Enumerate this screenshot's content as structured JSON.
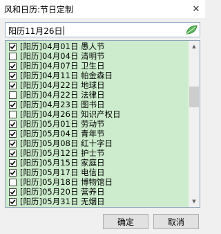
{
  "window": {
    "title": "风和日历:节日定制",
    "close_glyph": "✕"
  },
  "search": {
    "value": "阳历11月26日",
    "icon": "leaf-icon"
  },
  "list": {
    "items": [
      {
        "label": "[阳历]04月01日  愚人节",
        "checked": true
      },
      {
        "label": "[阳历]04月04日  清明节",
        "checked": false
      },
      {
        "label": "[阳历]04月07日  卫生日",
        "checked": true
      },
      {
        "label": "[阳历]04月11日  帕金森日",
        "checked": true
      },
      {
        "label": "[阳历]04月22日  地球日",
        "checked": true
      },
      {
        "label": "[阳历]04月22日  法律日",
        "checked": false
      },
      {
        "label": "[阳历]04月23日  图书日",
        "checked": true
      },
      {
        "label": "[阳历]04月26日  知识产权日",
        "checked": false
      },
      {
        "label": "[阳历]05月01日  劳动节",
        "checked": true
      },
      {
        "label": "[阳历]05月04日  青年节",
        "checked": true
      },
      {
        "label": "[阳历]05月08日  红十字日",
        "checked": true
      },
      {
        "label": "[阳历]05月12日  护士节",
        "checked": true
      },
      {
        "label": "[阳历]05月15日  家庭日",
        "checked": true
      },
      {
        "label": "[阳历]05月17日  电信日",
        "checked": true
      },
      {
        "label": "[阳历]05月18日  博物馆日",
        "checked": false
      },
      {
        "label": "[阳历]05月20日  营养日",
        "checked": true
      },
      {
        "label": "[阳历]05月31日  无烟日",
        "checked": true
      }
    ]
  },
  "buttons": {
    "ok": "确定",
    "cancel": "取消"
  },
  "colors": {
    "list_background": "#cdeccd",
    "leaf": "#4caf50"
  }
}
